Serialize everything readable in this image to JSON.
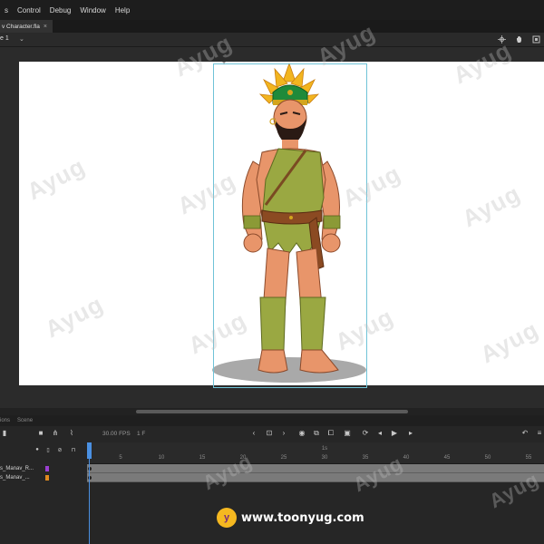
{
  "menu": {
    "items": [
      "s",
      "Control",
      "Debug",
      "Window",
      "Help"
    ]
  },
  "document": {
    "tab_label": "v Character.fla",
    "close_glyph": "×"
  },
  "scene": {
    "name": "e 1",
    "chevron": "⌄"
  },
  "timeline": {
    "panel_tabs": [
      "ions",
      "Scene"
    ],
    "fps": "30.00 FPS",
    "current_frame": "1 F",
    "ruler_ticks": [
      "5",
      "10",
      "15",
      "20",
      "25",
      "30",
      "35",
      "40",
      "45",
      "50",
      "55"
    ],
    "ruler_label_1s": "1s",
    "layers": [
      {
        "name": "s_Manav_R...",
        "color": "#9b3fd1"
      },
      {
        "name": "s_Manav_...",
        "color": "#e08a1e"
      }
    ]
  },
  "watermark_text": "Ayug",
  "brand": {
    "logo_glyph": "y",
    "url": "www.toonyug.com",
    "logo_color": "#f5b820"
  }
}
